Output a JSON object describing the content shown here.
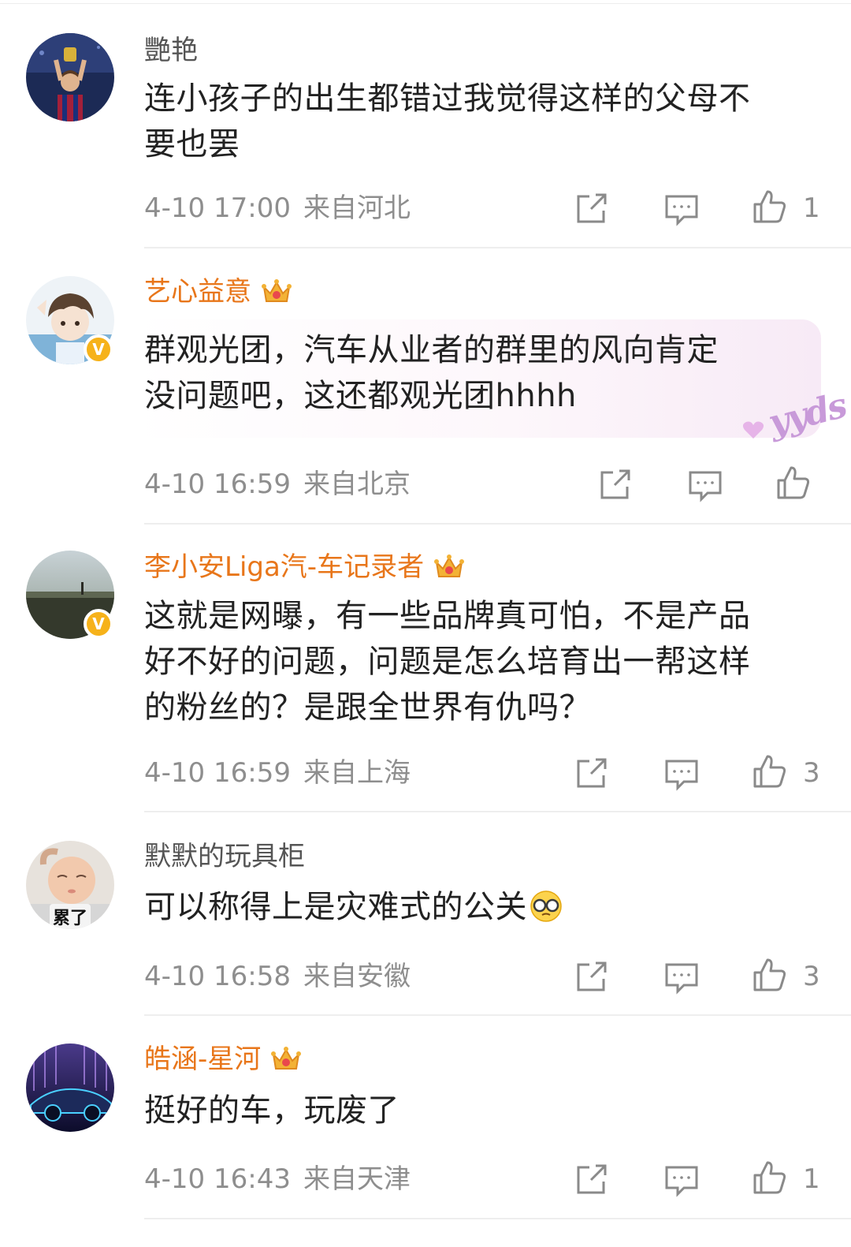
{
  "comments": [
    {
      "username": "艷艳",
      "text_lines": [
        "连小孩子的出生都错过我觉得这样的父母不",
        "要也罢"
      ],
      "time": "4-10 17:00",
      "location": "来自河北",
      "likes": "1",
      "vip": false,
      "verified": false
    },
    {
      "username": "艺心益意",
      "text_lines": [
        "群观光团，汽车从业者的群里的风向肯定",
        "没问题吧，这还都观光团hhhh"
      ],
      "time": "4-10 16:59",
      "location": "来自北京",
      "likes": "",
      "vip": true,
      "verified": true,
      "bubble_tag": "yyds"
    },
    {
      "username": "李小安Liga汽-车记录者",
      "text_lines": [
        "这就是网曝，有一些品牌真可怕，不是产品",
        "好不好的问题，问题是怎么培育出一帮这样",
        "的粉丝的？是跟全世界有仇吗？"
      ],
      "time": "4-10 16:59",
      "location": "来自上海",
      "likes": "3",
      "vip": true,
      "verified": true
    },
    {
      "username": "默默的玩具柜",
      "text_lines": [
        "可以称得上是灾难式的公关"
      ],
      "time": "4-10 16:58",
      "location": "来自安徽",
      "likes": "3",
      "vip": false,
      "verified": false,
      "avatar_caption": "累了"
    },
    {
      "username": "皓涵-星河",
      "text_lines": [
        "挺好的车，玩废了"
      ],
      "time": "4-10 16:43",
      "location": "来自天津",
      "likes": "1",
      "vip": true,
      "verified": false
    }
  ],
  "icons": {
    "share": "share-icon",
    "comment": "comment-icon",
    "like": "thumbs-up-icon",
    "crown": "vip-crown-icon",
    "verified": "verified-badge-icon"
  },
  "colors": {
    "vip_name": "#e8761a",
    "normal_name": "#555555",
    "text": "#222222",
    "meta": "#8e8e8e",
    "verified_badge": "#f6b21a"
  }
}
